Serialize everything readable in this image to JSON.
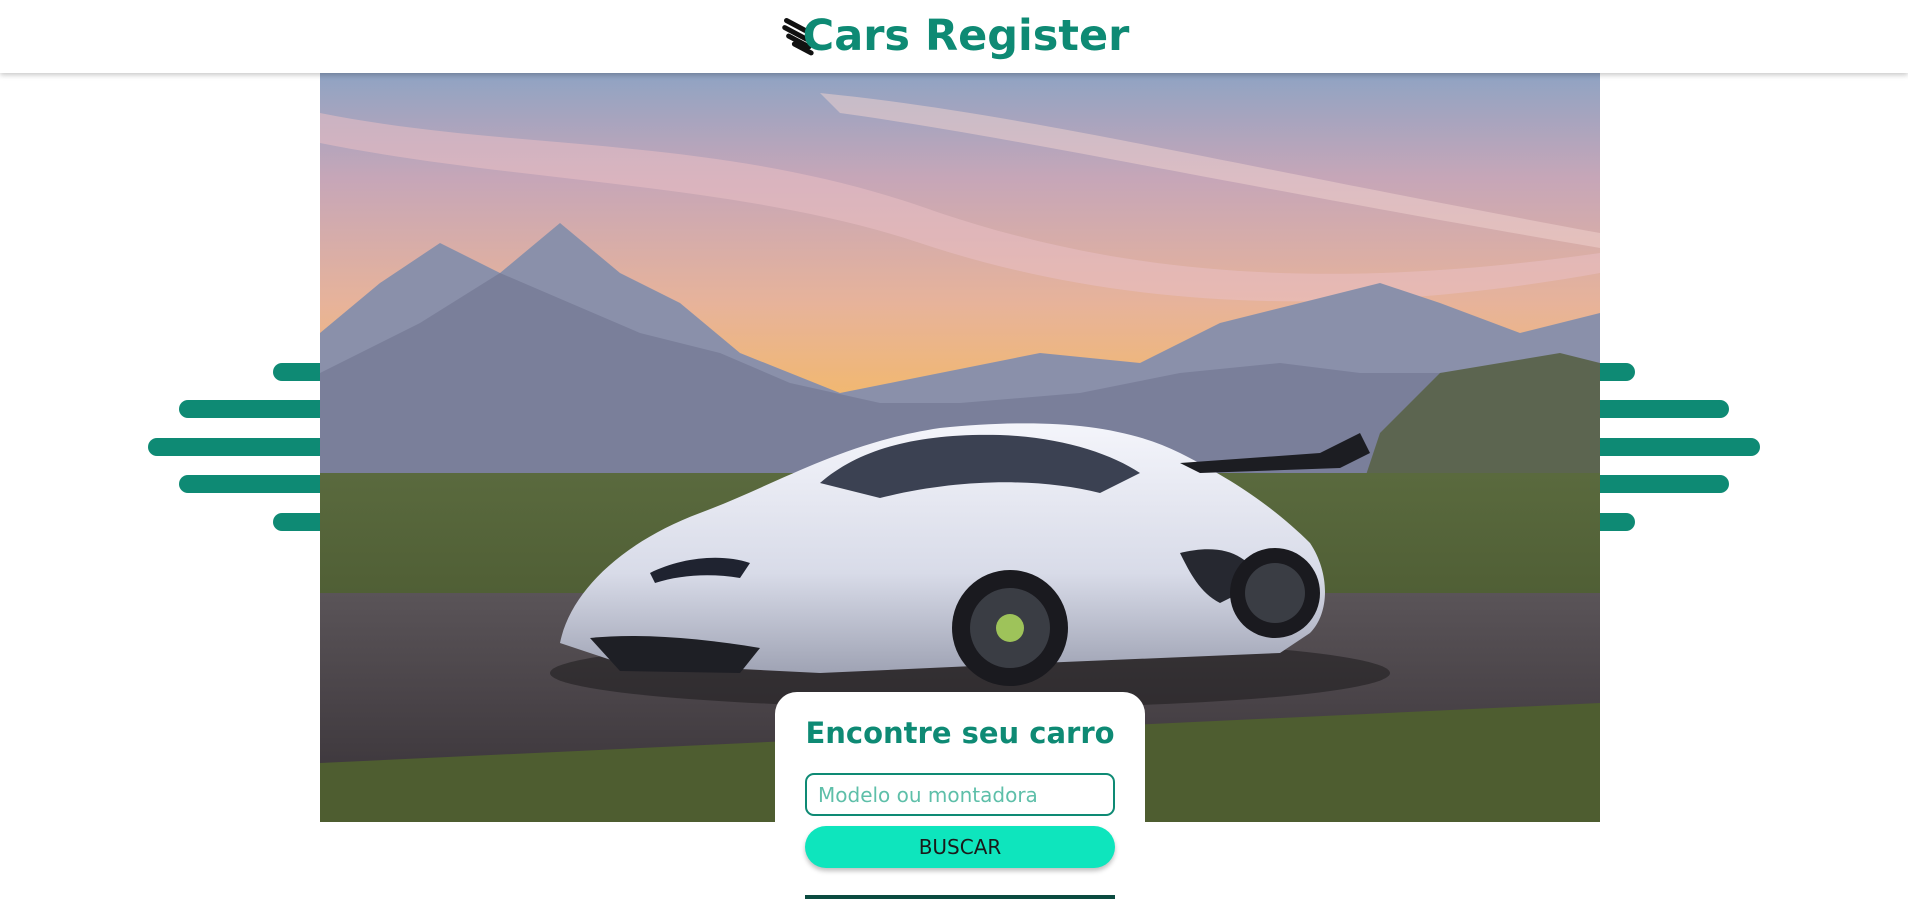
{
  "header": {
    "title": "Cars Register",
    "logo_icon": "speeding-c-logo-icon"
  },
  "hero": {
    "image_description_icon": "sports-car-photo"
  },
  "search_card": {
    "title": "Encontre seu carro",
    "input_placeholder": "Modelo ou montadora",
    "input_value": "",
    "button_label": "BUSCAR"
  },
  "colors": {
    "brand": "#0e8a74",
    "button": "#0ee5bd",
    "divider": "#0b4b40"
  }
}
